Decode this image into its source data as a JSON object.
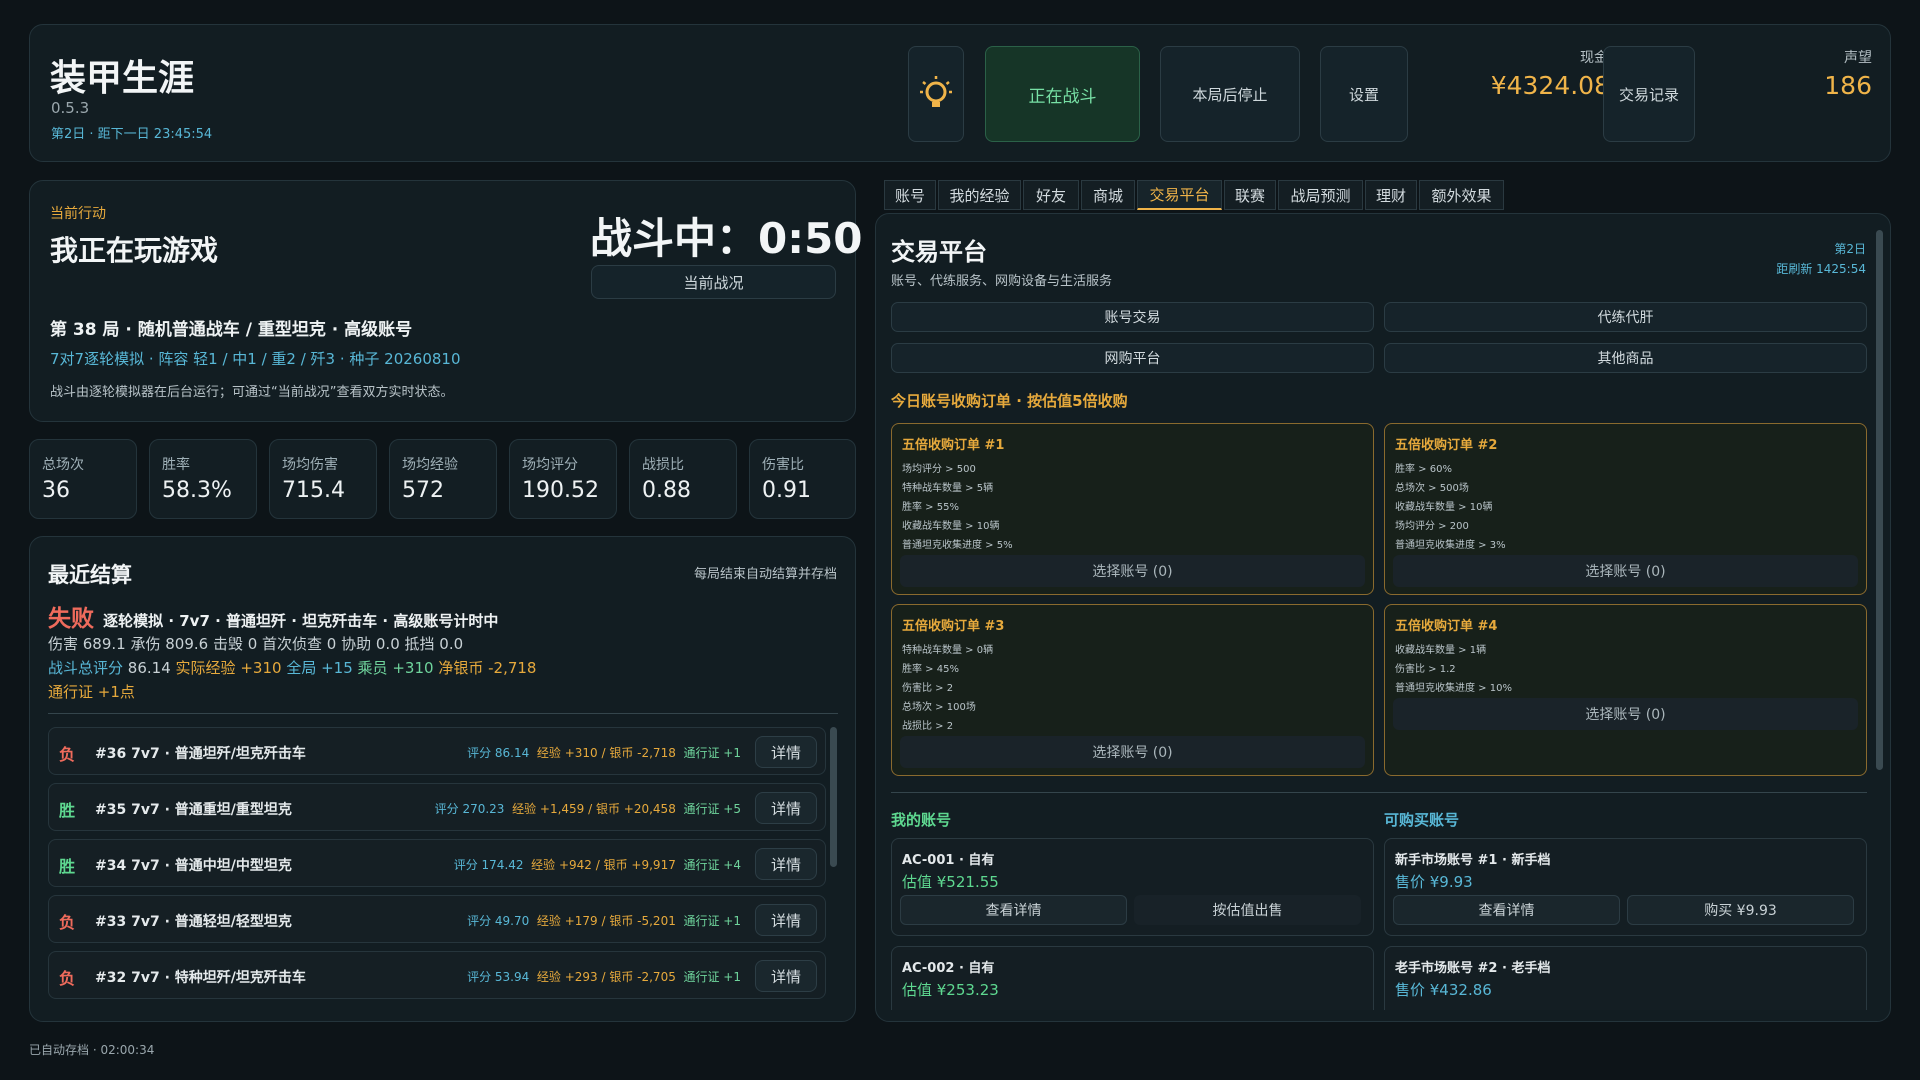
{
  "header": {
    "title": "装甲生涯",
    "version": "0.5.3",
    "day_info": "第2日 · 距下一日 23:45:54",
    "buttons": {
      "fighting": "正在战斗",
      "stop_after": "本局后停止",
      "settings": "设置",
      "trade_log": "交易记录"
    },
    "cash_label": "现金",
    "cash_value": "¥4324.08",
    "fame_label": "声望",
    "fame_value": "186"
  },
  "action": {
    "label": "当前行动",
    "title": "我正在玩游戏",
    "battle_status": "战斗中：0:50",
    "battle_button": "当前战况",
    "match_line": "第 38 局 · 随机普通战车 / 重型坦克 · 高级账号",
    "detail_line": "7对7逐轮模拟 · 阵容 轻1 / 中1 / 重2 / 歼3 · 种子 20260810",
    "note": "战斗由逐轮模拟器在后台运行；可通过“当前战况”查看双方实时状态。"
  },
  "stats": [
    {
      "label": "总场次",
      "value": "36"
    },
    {
      "label": "胜率",
      "value": "58.3%"
    },
    {
      "label": "场均伤害",
      "value": "715.4"
    },
    {
      "label": "场均经验",
      "value": "572"
    },
    {
      "label": "场均评分",
      "value": "190.52"
    },
    {
      "label": "战损比",
      "value": "0.88"
    },
    {
      "label": "伤害比",
      "value": "0.91"
    }
  ],
  "recent": {
    "title": "最近结算",
    "hint": "每局结束自动结算并存档",
    "last_result": "失败",
    "last_desc": "逐轮模拟 · 7v7 · 普通坦歼 · 坦克歼击车 · 高级账号计时中",
    "last_line2": "伤害 689.1 承伤 809.6 击毁 0 首次侦查 0 协助 0.0 抵挡 0.0",
    "score_label": "战斗总评分",
    "score_value": "86.14",
    "exp_label": "实际经验",
    "exp_value": "+310",
    "global_label": "全局",
    "global_value": "+15",
    "crew_label": "乘员",
    "crew_value": "+310",
    "silver_label": "净银币",
    "silver_value": "-2,718",
    "pass_line": "通行证 +1点",
    "rows": [
      {
        "res": "负",
        "title": "#36 7v7 · 普通坦歼/坦克歼击车",
        "score": "评分 86.14",
        "exp": "经验 +310 / 银币 -2,718",
        "pass": "通行证 +1",
        "btn": "详情"
      },
      {
        "res": "胜",
        "title": "#35 7v7 · 普通重坦/重型坦克",
        "score": "评分 270.23",
        "exp": "经验 +1,459 / 银币 +20,458",
        "pass": "通行证 +5",
        "btn": "详情"
      },
      {
        "res": "胜",
        "title": "#34 7v7 · 普通中坦/中型坦克",
        "score": "评分 174.42",
        "exp": "经验 +942 / 银币 +9,917",
        "pass": "通行证 +4",
        "btn": "详情"
      },
      {
        "res": "负",
        "title": "#33 7v7 · 普通轻坦/轻型坦克",
        "score": "评分 49.70",
        "exp": "经验 +179 / 银币 -5,201",
        "pass": "通行证 +1",
        "btn": "详情"
      },
      {
        "res": "负",
        "title": "#32 7v7 · 特种坦歼/坦克歼击车",
        "score": "评分 53.94",
        "exp": "经验 +293 / 银币 -2,705",
        "pass": "通行证 +1",
        "btn": "详情"
      }
    ]
  },
  "tabs": [
    "账号",
    "我的经验",
    "好友",
    "商城",
    "交易平台",
    "联赛",
    "战局预测",
    "理财",
    "额外效果"
  ],
  "market": {
    "title": "交易平台",
    "subtitle": "账号、代练服务、网购设备与生活服务",
    "day": "第2日",
    "refresh": "距刷新 1425:54",
    "categories": [
      "账号交易",
      "代练代肝",
      "网购平台",
      "其他商品"
    ],
    "orders_title": "今日账号收购订单 · 按估值5倍收购",
    "orders": [
      {
        "title": "五倍收购订单 #1",
        "reqs": [
          "场均评分 > 500",
          "特种战车数量 > 5辆",
          "胜率 > 55%",
          "收藏战车数量 > 10辆",
          "普通坦克收集进度 > 5%"
        ],
        "select": "选择账号 (0)"
      },
      {
        "title": "五倍收购订单 #2",
        "reqs": [
          "胜率 > 60%",
          "总场次 > 500场",
          "收藏战车数量 > 10辆",
          "场均评分 > 200",
          "普通坦克收集进度 > 3%"
        ],
        "select": "选择账号 (0)"
      },
      {
        "title": "五倍收购订单 #3",
        "reqs": [
          "特种战车数量 > 0辆",
          "胜率 > 45%",
          "伤害比 > 2",
          "总场次 > 100场",
          "战损比 > 2"
        ],
        "select": "选择账号 (0)"
      },
      {
        "title": "五倍收购订单 #4",
        "reqs": [
          "收藏战车数量 > 1辆",
          "伤害比 > 1.2",
          "普通坦克收集进度 > 10%"
        ],
        "select": "选择账号 (0)"
      }
    ],
    "my_accounts_title": "我的账号",
    "buy_accounts_title": "可购买账号",
    "my_accounts": [
      {
        "name": "AC-001 · 自有",
        "value": "估值 ¥521.55",
        "btn1": "查看详情",
        "btn2": "按估值出售"
      },
      {
        "name": "AC-002 · 自有",
        "value": "估值 ¥253.23"
      }
    ],
    "buy_accounts": [
      {
        "name": "新手市场账号 #1 · 新手档",
        "value": "售价 ¥9.93",
        "btn1": "查看详情",
        "btn2": "购买 ¥9.93"
      },
      {
        "name": "老手市场账号 #2 · 老手档",
        "value": "售价 ¥432.86"
      }
    ]
  },
  "footer": {
    "autosave": "已自动存档 · 02:00:34"
  }
}
